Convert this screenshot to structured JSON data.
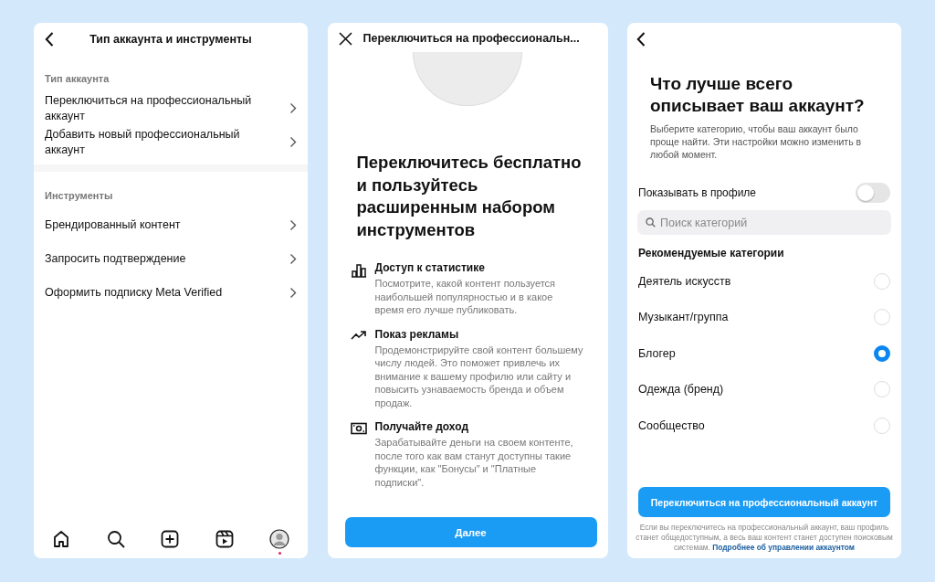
{
  "settings_screen": {
    "title": "Тип аккаунта и инструменты",
    "sections": [
      {
        "heading": "Тип аккаунта",
        "items": [
          "Переключиться на профессиональный аккаунт",
          "Добавить новый профессиональный аккаунт"
        ]
      },
      {
        "heading": "Инструменты",
        "items": [
          "Брендированный контент",
          "Запросить подтверждение",
          "Оформить подписку Meta Verified"
        ]
      }
    ],
    "nav": [
      {
        "kind": "home"
      },
      {
        "kind": "search"
      },
      {
        "kind": "create"
      },
      {
        "kind": "reels"
      },
      {
        "kind": "profile",
        "notification": true
      }
    ]
  },
  "intro_screen": {
    "title": "Переключиться на профессиональн...",
    "heading": "Переключитесь бесплатно и пользуйтесь расширенным набором инструментов",
    "features": [
      {
        "kind": "stats",
        "title": "Доступ к статистике",
        "text": "Посмотрите, какой контент пользуется наибольшей популярностью и в какое время его лучше публиковать."
      },
      {
        "kind": "ads",
        "title": "Показ рекламы",
        "text": "Продемонстрируйте свой контент большему числу людей. Это поможет привлечь их внимание к вашему профилю или сайту и повысить узнаваемость бренда и объем продаж."
      },
      {
        "kind": "money",
        "title": "Получайте доход",
        "text": "Зарабатывайте деньги на своем контенте, после того как вам станут доступны такие функции, как \"Бонусы\" и \"Платные подписки\"."
      }
    ],
    "button": "Далее"
  },
  "category_screen": {
    "heading": "Что лучше всего описывает ваш аккаунт?",
    "description": "Выберите категорию, чтобы ваш аккаунт было проще найти. Эти настройки можно изменить в любой момент.",
    "show_in_profile": {
      "label": "Показывать в профиле",
      "on": false
    },
    "search": {
      "placeholder": "Поиск категорий"
    },
    "list_heading": "Рекомендуемые категории",
    "categories": [
      {
        "label": "Деятель искусств",
        "selected": false
      },
      {
        "label": "Музыкант/группа",
        "selected": false
      },
      {
        "label": "Блогер",
        "selected": true
      },
      {
        "label": "Одежда (бренд)",
        "selected": false
      },
      {
        "label": "Сообщество",
        "selected": false
      }
    ],
    "button": "Переключиться на профессиональный аккаунт",
    "footnote": {
      "text": "Если вы переключитесь на профессиональный аккаунт, ваш профиль станет общедоступным, а весь ваш контент станет доступен поисковым системам.",
      "link": "Подробнее об управлении аккаунтом"
    }
  }
}
